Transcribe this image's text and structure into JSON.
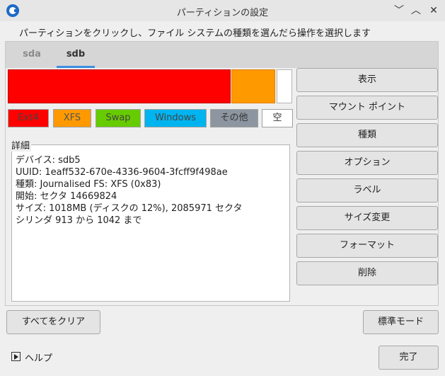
{
  "window": {
    "title": "パーティションの設定"
  },
  "instruction": "パーティションをクリックし、ファイル システムの種類を選んだら操作を選択します",
  "tabs": [
    {
      "label": "sda",
      "active": false
    },
    {
      "label": "sdb",
      "active": true
    }
  ],
  "partition_bar": {
    "segments": [
      {
        "color": "#ff0000"
      },
      {
        "color": "#ff9900"
      },
      {
        "color": "#ffffff"
      }
    ]
  },
  "legend": {
    "ext4": {
      "label": "Ext4",
      "color": "#ff0000"
    },
    "xfs": {
      "label": "XFS",
      "color": "#ff9900"
    },
    "swap": {
      "label": "Swap",
      "color": "#66cc00"
    },
    "windows": {
      "label": "Windows",
      "color": "#00b4f0"
    },
    "other": {
      "label": "その他",
      "color": "#8d96a0"
    },
    "empty": {
      "label": "空",
      "color": "#ffffff"
    }
  },
  "details": {
    "label": "詳細",
    "lines": [
      "デバイス: sdb5",
      "UUID: 1eaff532-670e-4336-9604-3fcff9f498ae",
      "種類: Journalised FS: XFS (0x83)",
      "開始: セクタ 14669824",
      "サイズ: 1018MB (ディスクの 12%), 2085971 セクタ",
      "シリンダ 913 から 1042 まで"
    ]
  },
  "actions": {
    "view": "表示",
    "mount_point": "マウント ポイント",
    "type": "種類",
    "options": "オプション",
    "label": "ラベル",
    "resize": "サイズ変更",
    "format": "フォーマット",
    "delete": "削除"
  },
  "footer": {
    "clear_all": "すべてをクリア",
    "mode": "標準モード",
    "help": "ヘルプ",
    "done": "完了"
  },
  "title_buttons": {
    "minimize": "﹀",
    "maximize": "︿",
    "close": "✕"
  }
}
